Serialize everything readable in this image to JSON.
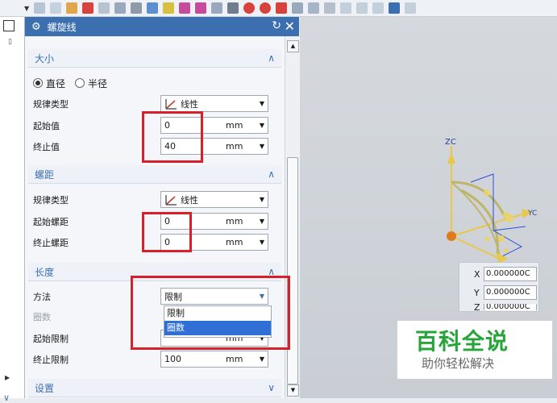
{
  "dialog": {
    "title": "螺旋线",
    "sections": {
      "size": {
        "header": "大小",
        "radio_diameter": "直径",
        "radio_radius": "半径",
        "law_type_label": "规律类型",
        "law_type_value": "线性",
        "start_label": "起始值",
        "start_value": "0",
        "start_unit": "mm",
        "end_label": "终止值",
        "end_value": "40",
        "end_unit": "mm"
      },
      "pitch": {
        "header": "螺距",
        "law_type_label": "规律类型",
        "law_type_value": "线性",
        "start_label": "起始螺距",
        "start_value": "0",
        "start_unit": "mm",
        "end_label": "终止螺距",
        "end_value": "0",
        "end_unit": "mm"
      },
      "length": {
        "header": "长度",
        "method_label": "方法",
        "method_value": "限制",
        "turns_label": "圈数",
        "start_limit_label": "起始限制",
        "start_limit_unit": "mm",
        "end_limit_label": "终止限制",
        "end_limit_value": "100",
        "end_limit_unit": "mm",
        "dropdown_options": [
          "限制",
          "圈数"
        ],
        "dropdown_selected": "圈数"
      },
      "settings": {
        "header": "设置"
      }
    }
  },
  "viewport": {
    "axis_z": "ZC",
    "axis_y": "YC",
    "coords": {
      "x_label": "X",
      "x_value": "0.000000C",
      "y_label": "Y",
      "y_value": "0.000000C",
      "z_label": "Z",
      "z_value": "0.000000C"
    }
  },
  "watermark": {
    "title": "百科全说",
    "subtitle": "助你轻松解决"
  },
  "colors": {
    "accent": "#3c6fb0",
    "highlight": "#d8202a",
    "selected": "#2f6fd6",
    "brand": "#27a43a"
  }
}
